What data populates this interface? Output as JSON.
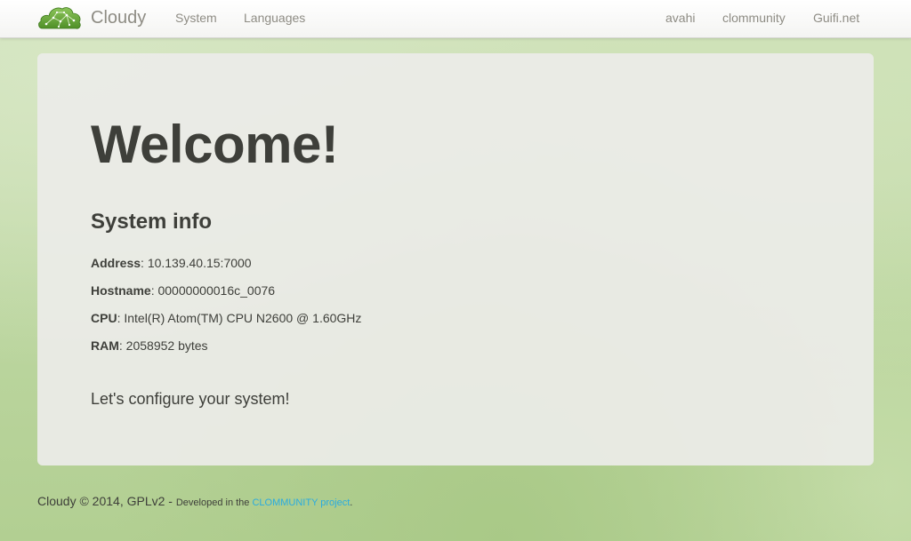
{
  "navbar": {
    "brand": "Cloudy",
    "left_links": [
      "System",
      "Languages"
    ],
    "right_links": [
      "avahi",
      "clommunity",
      "Guifi.net"
    ]
  },
  "main": {
    "heading": "Welcome!",
    "section_title": "System info",
    "info": [
      {
        "label": "Address",
        "value": "10.139.40.15:7000"
      },
      {
        "label": "Hostname",
        "value": "00000000016c_0076"
      },
      {
        "label": "CPU",
        "value": "Intel(R) Atom(TM) CPU N2600 @ 1.60GHz"
      },
      {
        "label": "RAM",
        "value": "2058952 bytes"
      }
    ],
    "separator": ": ",
    "cta": "Let's configure your system!"
  },
  "footer": {
    "text": "Cloudy © 2014, GPLv2 - ",
    "small_text": "Developed in the ",
    "link_text": "CLOMMUNITY project",
    "trailing": "."
  },
  "colors": {
    "nav_text": "#8e8c84",
    "body_text": "#3e3f3a",
    "link": "#29abe0",
    "logo_green": "#6cab3a"
  },
  "icons": {
    "brand_logo": "cloud-network-icon"
  }
}
